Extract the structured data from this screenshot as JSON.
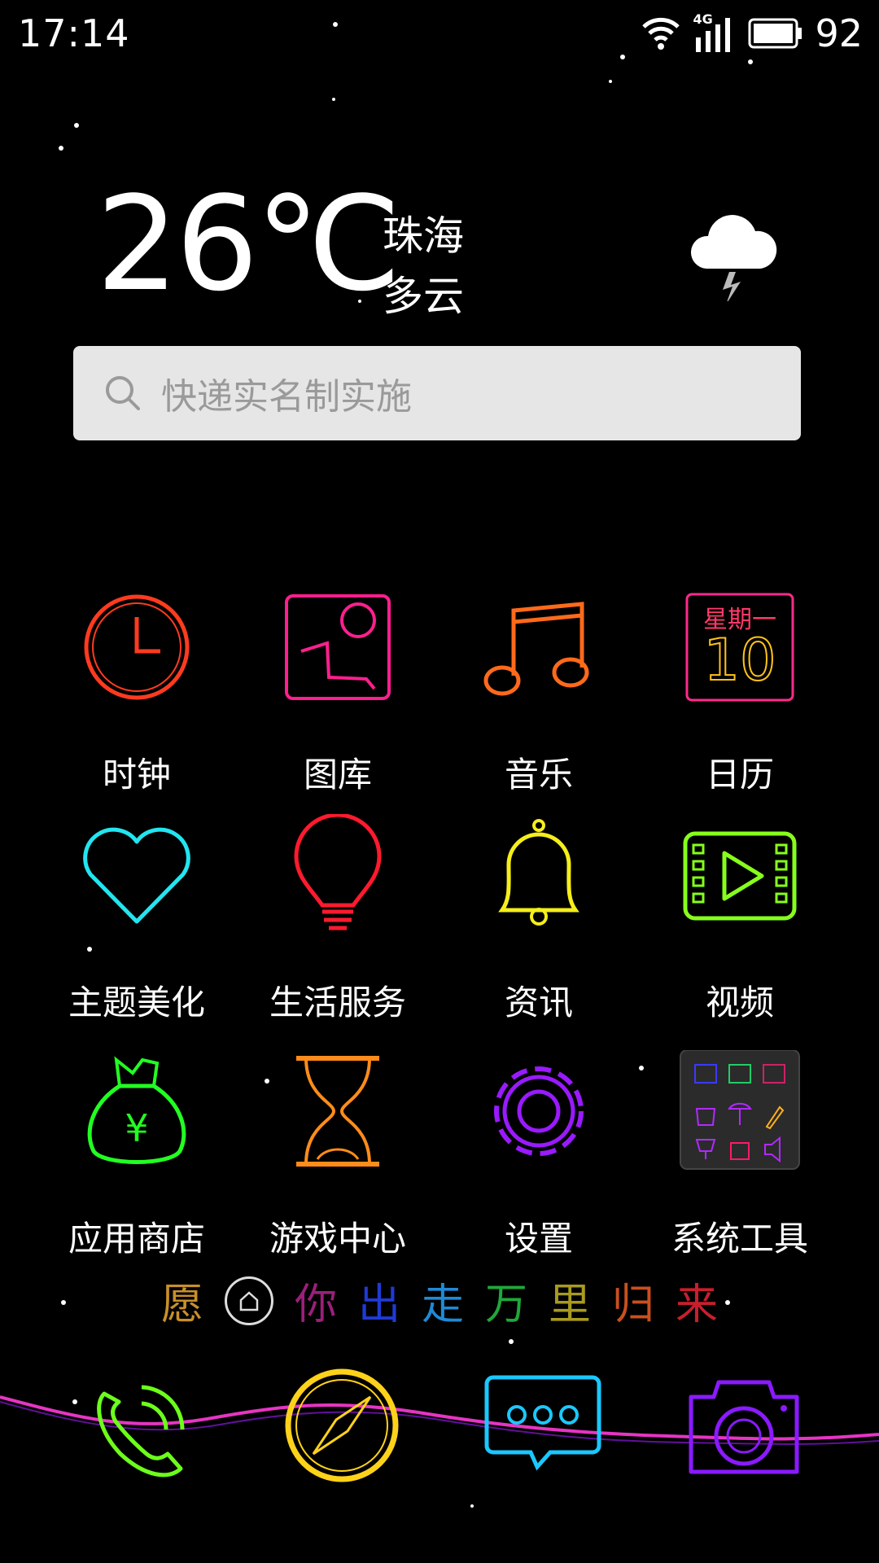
{
  "status_bar": {
    "time": "17:14",
    "network": "4G",
    "battery": "92"
  },
  "weather": {
    "temperature": "26℃",
    "city": "珠海",
    "condition": "多云",
    "icon": "thunder-cloud-icon"
  },
  "search": {
    "placeholder": "快递实名制实施"
  },
  "apps": [
    {
      "label": "时钟",
      "icon": "clock-icon",
      "color": "#ff3b1f"
    },
    {
      "label": "图库",
      "icon": "gallery-icon",
      "color": "#ff1f8e"
    },
    {
      "label": "音乐",
      "icon": "music-note-icon",
      "color": "#ff6a1a"
    },
    {
      "label": "日历",
      "icon": "calendar-icon",
      "color": "#ff2a8a"
    },
    {
      "label": "主题美化",
      "icon": "heart-icon",
      "color": "#22e5f0"
    },
    {
      "label": "生活服务",
      "icon": "lightbulb-icon",
      "color": "#ff1a2e"
    },
    {
      "label": "资讯",
      "icon": "bell-icon",
      "color": "#f5ee1a"
    },
    {
      "label": "视频",
      "icon": "video-play-icon",
      "color": "#86ff1a"
    },
    {
      "label": "应用商店",
      "icon": "money-bag-icon",
      "color": "#22ff22"
    },
    {
      "label": "游戏中心",
      "icon": "hourglass-icon",
      "color": "#ff8c1a"
    },
    {
      "label": "设置",
      "icon": "gear-icon",
      "color": "#9a1aff"
    },
    {
      "label": "系统工具",
      "icon": "tools-folder-icon",
      "color": "#8a2be2"
    }
  ],
  "calendar_icon": {
    "weekday": "星期一",
    "day": "10"
  },
  "slogan": {
    "chars": [
      {
        "text": "愿",
        "color": "#c8902a"
      },
      {
        "text": "你",
        "color": "#9b1f7a"
      },
      {
        "text": "出",
        "color": "#1f3ad6"
      },
      {
        "text": "走",
        "color": "#1f8ad6"
      },
      {
        "text": "万",
        "color": "#1fa83a"
      },
      {
        "text": "里",
        "color": "#a89a1f"
      },
      {
        "text": "归",
        "color": "#c8501f"
      },
      {
        "text": "来",
        "color": "#c81f2e"
      }
    ]
  },
  "dock": [
    {
      "icon": "phone-icon",
      "color": "#6cff1a"
    },
    {
      "icon": "compass-icon",
      "color": "#ffd21a"
    },
    {
      "icon": "messages-icon",
      "color": "#1ac8ff"
    },
    {
      "icon": "camera-icon",
      "color": "#8a1aff"
    }
  ]
}
